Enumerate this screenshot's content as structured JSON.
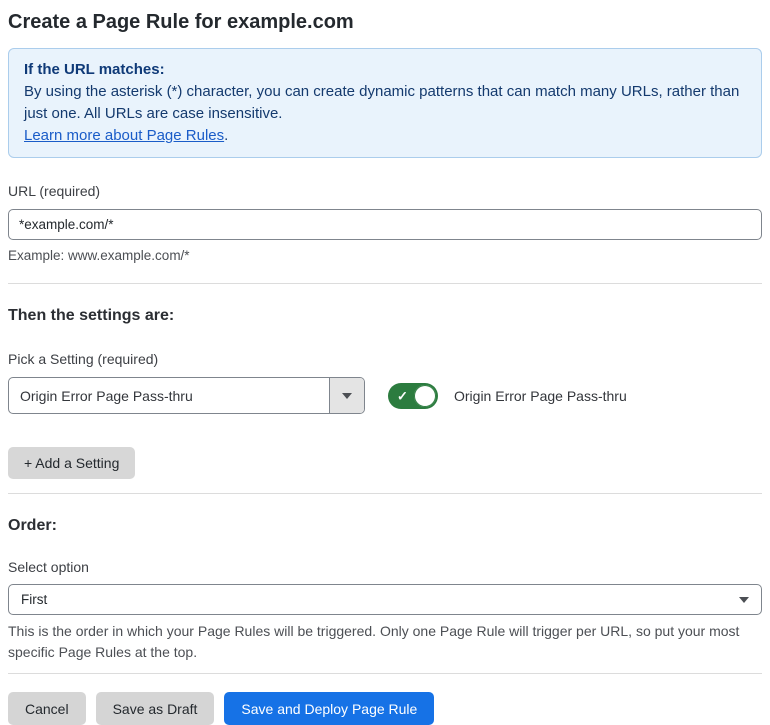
{
  "page": {
    "title": "Create a Page Rule for example.com"
  },
  "info_box": {
    "heading": "If the URL matches:",
    "body": "By using the asterisk (*) character, you can create dynamic patterns that can match many URLs, rather than just one. All URLs are case insensitive.",
    "link": "Learn more about Page Rules",
    "link_suffix": "."
  },
  "url_field": {
    "label": "URL (required)",
    "value": "*example.com/*",
    "example": "Example: www.example.com/*"
  },
  "settings_section": {
    "heading": "Then the settings are:",
    "picker_label": "Pick a Setting (required)",
    "picker_value": "Origin Error Page Pass-thru",
    "toggle_state": "on",
    "toggle_check": "✓",
    "toggle_label": "Origin Error Page Pass-thru",
    "add_button": "+ Add a Setting"
  },
  "order_section": {
    "heading": "Order:",
    "select_label": "Select option",
    "select_value": "First",
    "help": "This is the order in which your Page Rules will be triggered. Only one Page Rule will trigger per URL, so put your most specific Page Rules at the top."
  },
  "footer": {
    "cancel": "Cancel",
    "save_draft": "Save as Draft",
    "save_deploy": "Save and Deploy Page Rule"
  },
  "colors": {
    "primary_blue": "#1672e6",
    "toggle_green": "#2c7c3f",
    "info_bg": "#e9f3fc",
    "info_border": "#abcdec",
    "info_text": "#143a6e",
    "link_blue": "#1a5cc8",
    "button_gray": "#d5d5d5"
  }
}
